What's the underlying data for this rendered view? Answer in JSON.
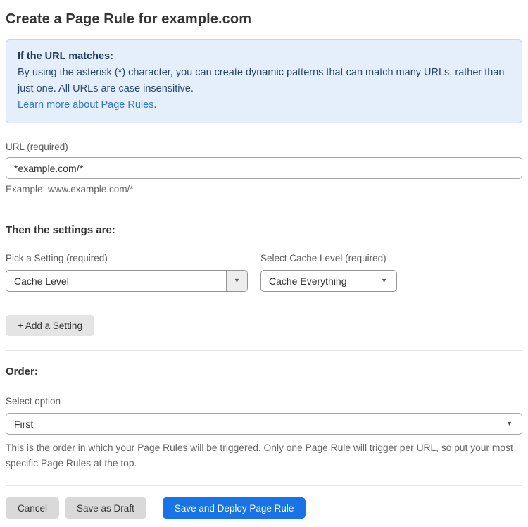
{
  "page": {
    "title": "Create a Page Rule for example.com"
  },
  "info_box": {
    "heading": "If the URL matches:",
    "body": "By using the asterisk (*) character, you can create dynamic patterns that can match many URLs, rather than just one. All URLs are case insensitive.",
    "link_label": "Learn more about Page Rules",
    "link_suffix": "."
  },
  "url_field": {
    "label": "URL (required)",
    "value": "*example.com/*",
    "example": "Example: www.example.com/*"
  },
  "settings": {
    "heading": "Then the settings are:",
    "setting_picker": {
      "label": "Pick a Setting (required)",
      "selected": "Cache Level"
    },
    "cache_level_picker": {
      "label": "Select Cache Level (required)",
      "selected": "Cache Everything"
    },
    "add_button_label": "+ Add a Setting"
  },
  "order": {
    "heading": "Order:",
    "label": "Select option",
    "selected": "First",
    "help": "This is the order in which your Page Rules will be triggered. Only one Page Rule will trigger per URL, so put your most specific Page Rules at the top."
  },
  "actions": {
    "cancel": "Cancel",
    "save_draft": "Save as Draft",
    "save_deploy": "Save and Deploy Page Rule"
  },
  "icons": {
    "chevron_down": "▼"
  },
  "colors": {
    "info_bg": "#e5effb",
    "info_border": "#bed8f3",
    "info_text": "#27466f",
    "link_blue": "#2f77d3",
    "primary_blue": "#1773e6",
    "button_gray": "#d9d9d9"
  }
}
